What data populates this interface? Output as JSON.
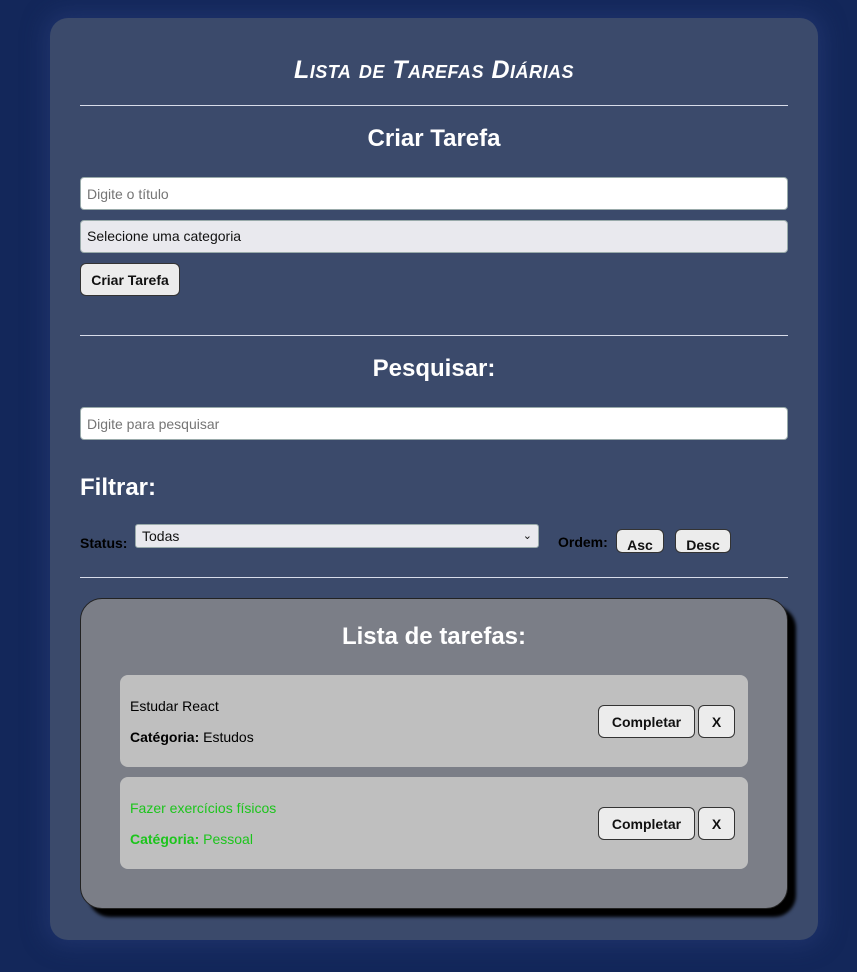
{
  "app": {
    "title": "Lista de Tarefas Diárias"
  },
  "create": {
    "heading": "Criar Tarefa",
    "title_placeholder": "Digite o título",
    "category_select": "Selecione uma categoria",
    "submit_label": "Criar Tarefa"
  },
  "search": {
    "heading": "Pesquisar:",
    "placeholder": "Digite para pesquisar"
  },
  "filter": {
    "heading": "Filtrar:",
    "status_label": "Status:",
    "status_value": "Todas",
    "order_label": "Ordem:",
    "asc_label": "Asc",
    "desc_label": "Desc"
  },
  "list": {
    "heading": "Lista de tarefas:",
    "category_label": "Catégoria:",
    "complete_label": "Completar",
    "remove_label": "X",
    "tasks": [
      {
        "title": "Estudar React",
        "category": "Estudos",
        "completed": false
      },
      {
        "title": "Fazer exercícios físicos",
        "category": "Pessoal",
        "completed": true
      }
    ]
  },
  "colors": {
    "background": "#13275a",
    "app": "#3b4a6b",
    "panel": "#7b7e87",
    "task": "#bfbfbf",
    "completed_text": "#1cc51c"
  }
}
